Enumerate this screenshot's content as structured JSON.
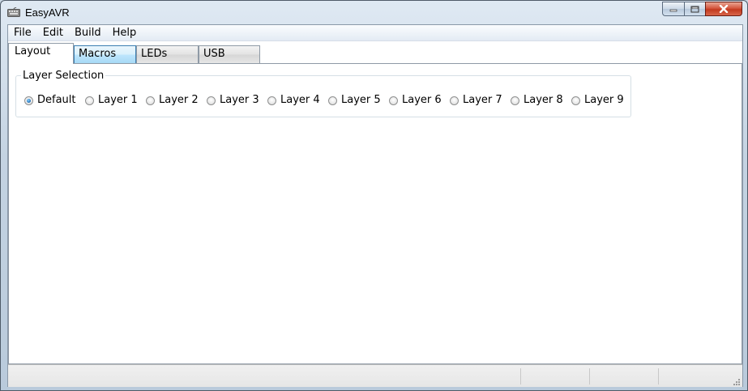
{
  "window": {
    "title": "EasyAVR",
    "icon": "keyboard-icon",
    "controls": [
      "minimize-icon",
      "maximize-icon",
      "close-icon"
    ]
  },
  "menu": {
    "items": [
      {
        "label": "File"
      },
      {
        "label": "Edit"
      },
      {
        "label": "Build"
      },
      {
        "label": "Help"
      }
    ]
  },
  "tabs": {
    "items": [
      {
        "label": "Layout",
        "active": true
      },
      {
        "label": "Macros",
        "active": false
      },
      {
        "label": "LEDs",
        "active": false
      },
      {
        "label": "USB",
        "active": false
      }
    ]
  },
  "layer_selection": {
    "legend": "Layer Selection",
    "selected": "Default",
    "options": [
      {
        "label": "Default"
      },
      {
        "label": "Layer 1"
      },
      {
        "label": "Layer 2"
      },
      {
        "label": "Layer 3"
      },
      {
        "label": "Layer 4"
      },
      {
        "label": "Layer 5"
      },
      {
        "label": "Layer 6"
      },
      {
        "label": "Layer 7"
      },
      {
        "label": "Layer 8"
      },
      {
        "label": "Layer 9"
      }
    ]
  },
  "colors": {
    "accent": "#3c7fb1",
    "close_button": "#c23a1f"
  }
}
